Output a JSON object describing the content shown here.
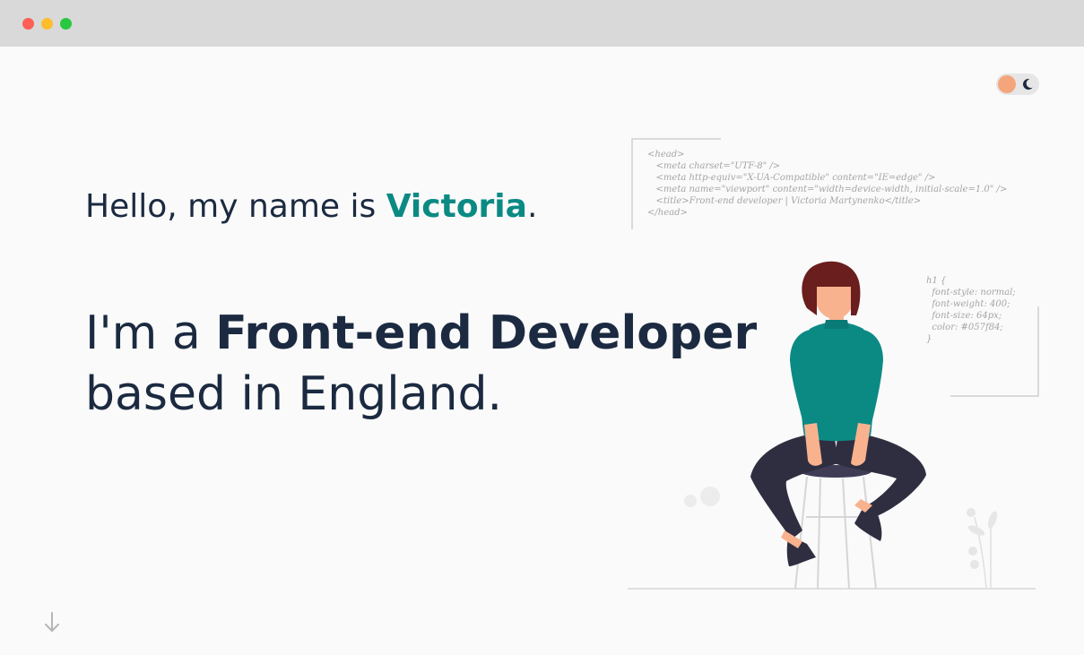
{
  "window": {
    "controls": [
      "close",
      "minimize",
      "maximize"
    ]
  },
  "theme_toggle": {
    "sun_icon": "sun-icon",
    "moon_icon": "moon-icon"
  },
  "hero": {
    "greeting_prefix": "Hello, my name is ",
    "name": "Victoria",
    "greeting_suffix": ".",
    "line1_prefix": "I'm a ",
    "role": "Front-end Developer",
    "line2": "based in England."
  },
  "code_snippets": {
    "head": [
      "<head>",
      "   <meta charset=\"UTF-8\" />",
      "   <meta http-equiv=\"X-UA-Compatible\" content=\"IE=edge\" />",
      "   <meta name=\"viewport\" content=\"width=device-width, initial-scale=1.0\" />",
      "   <title>Front-end developer | Victoria Martynenko</title>",
      "</head>"
    ],
    "css": [
      "h1 {",
      "  font-style: normal;",
      "  font-weight: 400;",
      "  font-size: 64px;",
      "  color: #057f84;",
      "}"
    ]
  },
  "colors": {
    "accent": "#0b8a84",
    "text": "#1b2a40",
    "background": "#fafafa",
    "toggle_sun": "#f4a57c"
  },
  "icons": {
    "scroll_down": "arrow-down-icon"
  }
}
